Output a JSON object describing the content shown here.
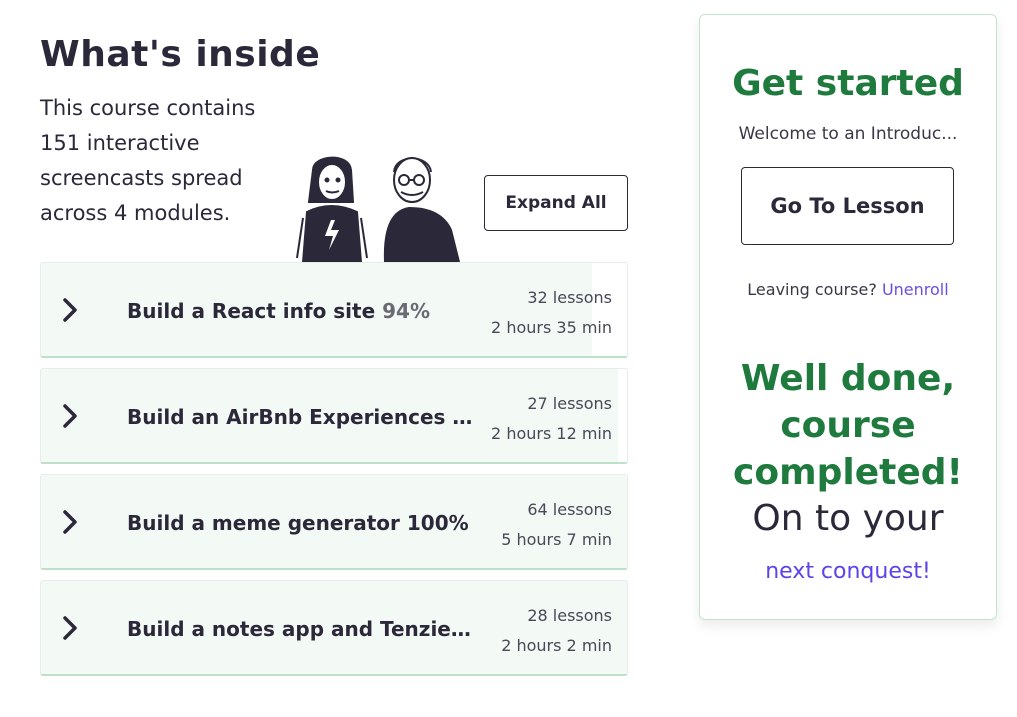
{
  "inside": {
    "title": "What's inside",
    "description": "This course contains 151 interactive screencasts spread across 4 modules.",
    "expand_all_label": "Expand All"
  },
  "modules": [
    {
      "title": "Build a React info site",
      "percent": "94%",
      "progress": 0.94,
      "lessons": "32 lessons",
      "duration": "2 hours 35 min"
    },
    {
      "title": "Build an AirBnb Experiences cl...",
      "percent": "",
      "progress": 0.985,
      "lessons": "27 lessons",
      "duration": "2 hours 12 min"
    },
    {
      "title": "Build a meme generator",
      "percent": "100%",
      "progress": 1.0,
      "lessons": "64 lessons",
      "duration": "5 hours 7 min"
    },
    {
      "title": "Build a notes app and Tenzies g...",
      "percent": "",
      "progress": 1.0,
      "lessons": "28 lessons",
      "duration": "2 hours 2 min"
    }
  ],
  "sidebar": {
    "heading": "Get started",
    "welcome": "Welcome to an Introduc...",
    "go_to_lesson_label": "Go To Lesson",
    "leaving_text": "Leaving course?",
    "unenroll_label": "Unenroll",
    "done_message": "Well done, course completed!",
    "onto_text": "On to your",
    "next_link": "next conquest!"
  },
  "colors": {
    "accent_green": "#1f7a3e",
    "link_purple": "#5b44e8",
    "progress_fill": "#f3f9f4"
  }
}
